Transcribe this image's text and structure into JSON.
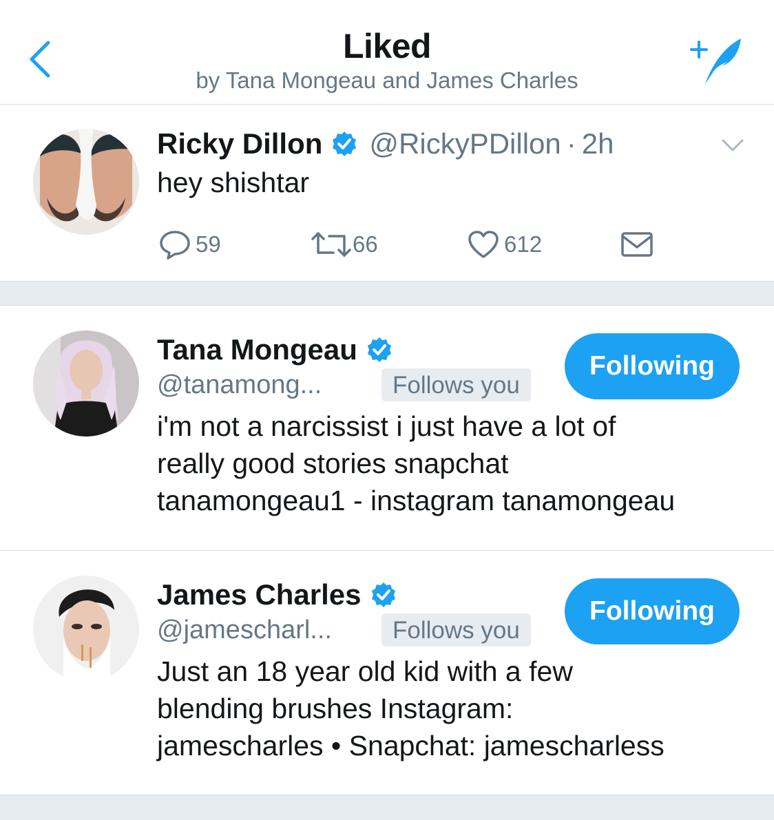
{
  "header": {
    "title": "Liked",
    "subtitle": "by Tana Mongeau and James Charles"
  },
  "tweet": {
    "name": "Ricky Dillon",
    "handle": "@RickyPDillon",
    "separator": "·",
    "time": "2h",
    "text": "hey shishtar",
    "replies": "59",
    "retweets": "66",
    "likes": "612"
  },
  "users": [
    {
      "name": "Tana Mongeau",
      "handle": "@tanamong...",
      "follows_badge": "Follows you",
      "button": "Following",
      "bio_lines": [
        "i'm not a narcissist i just have a lot of",
        "really good stories snapchat",
        "tanamongeau1 - instagram tanamongeau"
      ]
    },
    {
      "name": "James Charles",
      "handle": "@jamescharl...",
      "follows_badge": "Follows you",
      "button": "Following",
      "bio_lines": [
        "Just an 18 year old kid with a few",
        "blending brushes Instagram:",
        "jamescharles • Snapchat: jamescharless"
      ]
    }
  ],
  "colors": {
    "accent": "#1da1f2",
    "secondary_text": "#657786",
    "divider_bg": "#e6ecf0"
  }
}
